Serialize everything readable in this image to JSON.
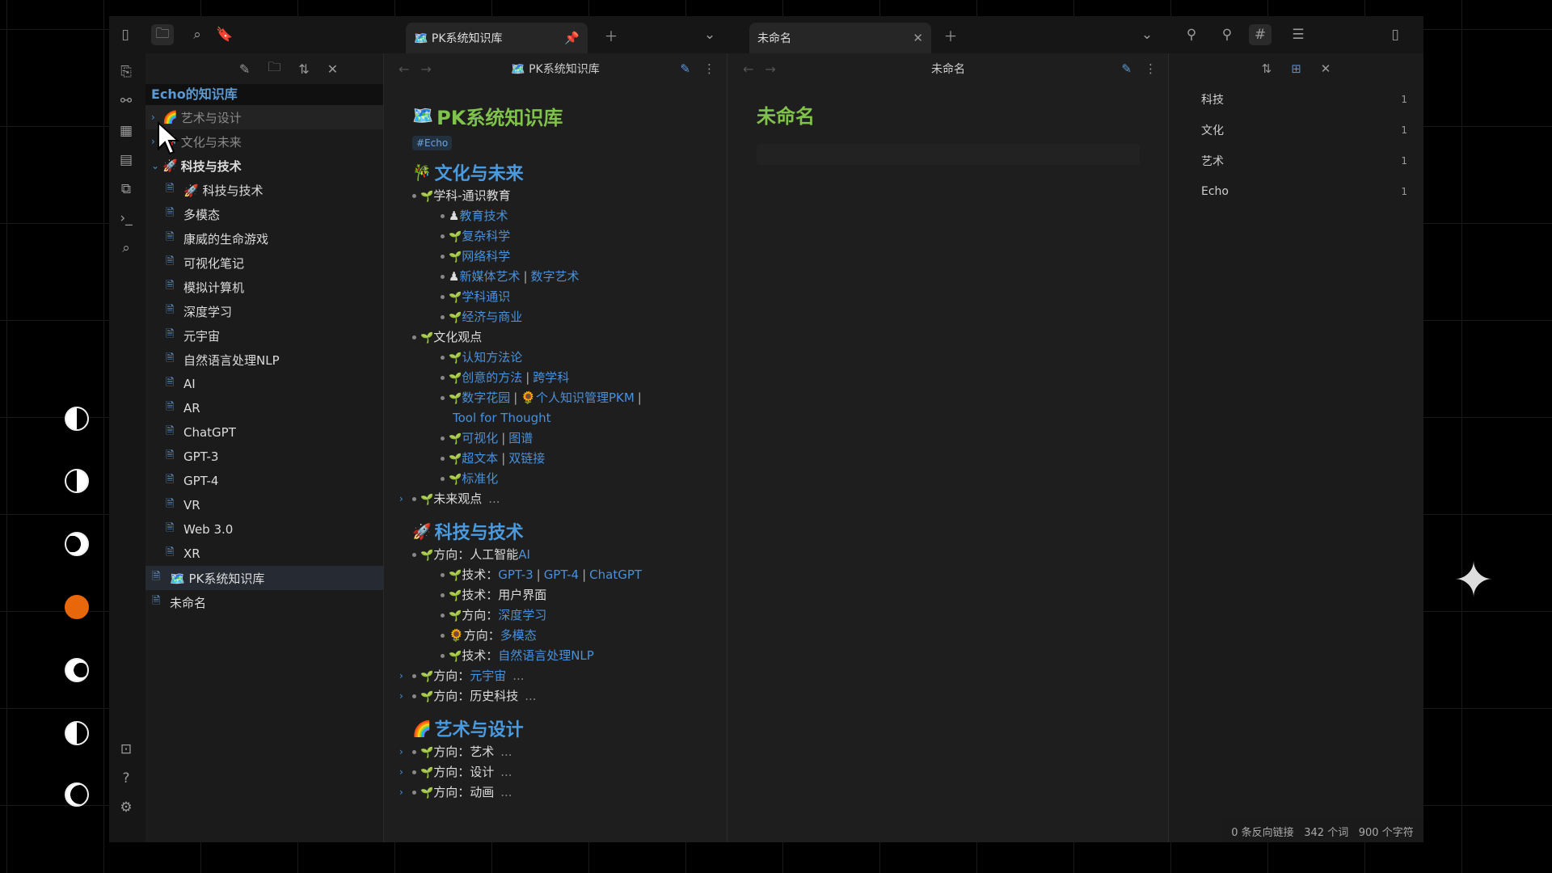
{
  "titlebar": {
    "left_tab": {
      "title": "🗺️ PK系统知识库"
    },
    "right_tab": {
      "title": "未命名"
    }
  },
  "sidebar": {
    "vault_name": "Echo的知识库",
    "folders": [
      {
        "label": "艺术与设计",
        "emoji": "🌈",
        "state": "collapsed"
      },
      {
        "label": "文化与未来",
        "emoji": "🎋",
        "state": "collapsed"
      },
      {
        "label": "科技与技术",
        "emoji": "🚀",
        "state": "expanded"
      }
    ],
    "files": [
      "🚀 科技与技术",
      "多模态",
      "康威的生命游戏",
      "可视化笔记",
      "模拟计算机",
      "深度学习",
      "元宇宙",
      "自然语言处理NLP",
      "AI",
      "AR",
      "ChatGPT",
      "GPT-3",
      "GPT-4",
      "VR",
      "Web 3.0",
      "XR"
    ],
    "root_files": [
      "🗺️ PK系统知识库",
      "未命名"
    ]
  },
  "left_pane": {
    "header_title": "🗺️ PK系统知识库",
    "doc_title": "PK系统知识库",
    "doc_emoji": "🗺️",
    "tag": "#Echo",
    "sections": [
      {
        "heading": "文化与未来",
        "emoji": "🎋",
        "items": [
          {
            "level": 1,
            "text": "学科-通识教育",
            "links": []
          },
          {
            "level": 2,
            "prefix": "♟",
            "links": [
              "教育技术"
            ]
          },
          {
            "level": 2,
            "links": [
              "复杂科学"
            ]
          },
          {
            "level": 2,
            "links": [
              "网络科学"
            ]
          },
          {
            "level": 2,
            "prefix": "♟",
            "links": [
              "新媒体艺术",
              "数字艺术"
            ]
          },
          {
            "level": 2,
            "links": [
              "学科通识"
            ]
          },
          {
            "level": 2,
            "links": [
              "经济与商业"
            ]
          },
          {
            "level": 1,
            "text": "文化观点",
            "links": []
          },
          {
            "level": 2,
            "links": [
              "认知方法论"
            ]
          },
          {
            "level": 2,
            "links": [
              "创意的方法",
              "跨学科"
            ]
          },
          {
            "level": 2,
            "links": [
              "数字花园",
              "🌻个人知识管理PKM"
            ],
            "wrap": "Tool for Thought"
          },
          {
            "level": 2,
            "links": [
              "可视化",
              "图谱"
            ]
          },
          {
            "level": 2,
            "links": [
              "超文本",
              "双链接"
            ]
          },
          {
            "level": 2,
            "links": [
              "标准化"
            ]
          },
          {
            "level": 1,
            "text": "未来观点",
            "folded": true
          }
        ]
      },
      {
        "heading": "科技与技术",
        "emoji": "🚀",
        "items": [
          {
            "level": 1,
            "text": "方向：人工智能",
            "links": [
              "AI"
            ]
          },
          {
            "level": 2,
            "text": "技术：",
            "links": [
              "GPT-3",
              "GPT-4",
              "ChatGPT"
            ]
          },
          {
            "level": 2,
            "text": "技术：用户界面",
            "links": []
          },
          {
            "level": 2,
            "text": "方向：",
            "links": [
              "深度学习"
            ]
          },
          {
            "level": 2,
            "prefix": "🌻",
            "text": "方向：",
            "links": [
              "多模态"
            ]
          },
          {
            "level": 2,
            "text": "技术：",
            "links": [
              "自然语言处理NLP"
            ]
          },
          {
            "level": 1,
            "text": "方向：",
            "links": [
              "元宇宙"
            ],
            "folded": true
          },
          {
            "level": 1,
            "text": "方向：历史科技",
            "folded": true
          }
        ]
      },
      {
        "heading": "艺术与设计",
        "emoji": "🌈",
        "items": [
          {
            "level": 1,
            "text": "方向：艺术",
            "folded": true
          },
          {
            "level": 1,
            "text": "方向：设计",
            "folded": true
          },
          {
            "level": 1,
            "text": "方向：动画",
            "folded": true
          }
        ]
      }
    ],
    "ellipsis": "..."
  },
  "right_pane": {
    "header_title": "未命名",
    "doc_title": "未命名"
  },
  "tags_panel": {
    "tags": [
      {
        "name": "科技",
        "count": "1"
      },
      {
        "name": "文化",
        "count": "1"
      },
      {
        "name": "艺术",
        "count": "1"
      },
      {
        "name": "Echo",
        "count": "1"
      }
    ]
  },
  "status": {
    "backlinks": "0 条反向链接",
    "words": "342 个词",
    "chars": "900 个字符"
  },
  "colors": {
    "accent": "#4a90d9",
    "heading_green": "#7fc34a",
    "orange_moon": "#e8670a"
  }
}
